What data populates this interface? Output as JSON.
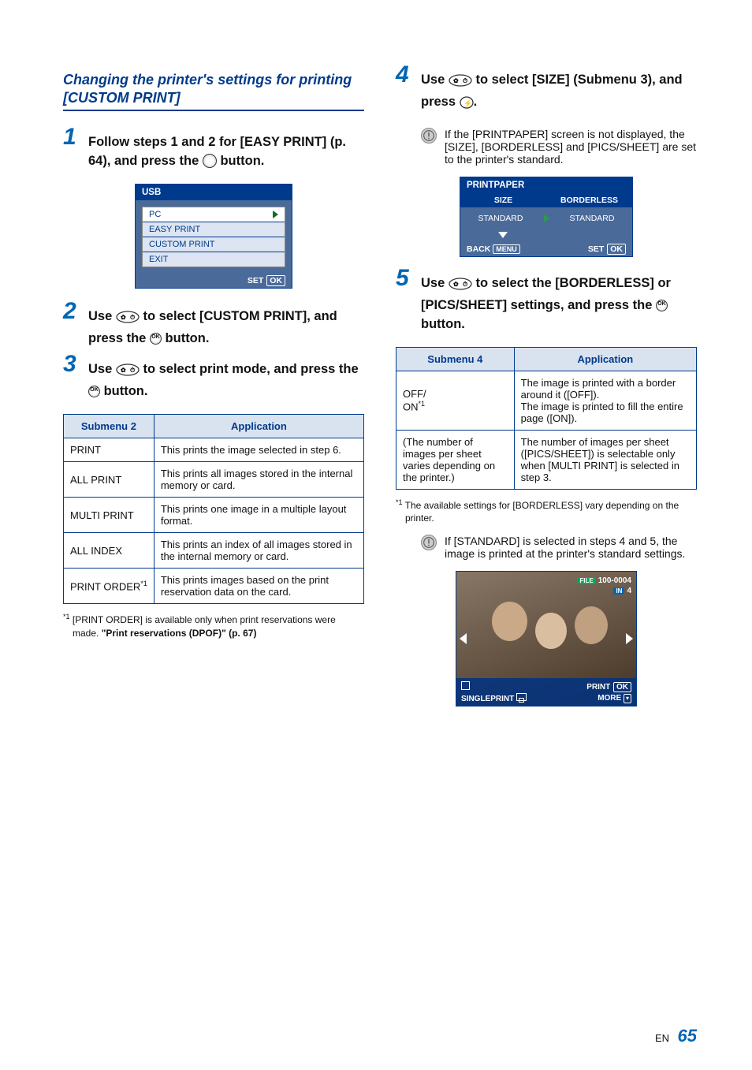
{
  "left": {
    "title": "Changing the printer's settings for printing [CUSTOM PRINT]",
    "step1": {
      "num": "1",
      "label_parts": [
        "Follow steps 1 and 2 for [EASY PRINT] (p. 64), and press the ",
        " button."
      ]
    },
    "usb": {
      "header": "USB",
      "items": [
        "PC",
        "EASY PRINT",
        "CUSTOM PRINT",
        "EXIT"
      ],
      "footer_set": "SET",
      "footer_ok": "OK"
    },
    "step2": {
      "num": "2",
      "label_parts": [
        "Use ",
        " to select [CUSTOM PRINT], and press the ",
        " button."
      ]
    },
    "step3": {
      "num": "3",
      "label_parts": [
        "Use ",
        " to select print mode, and press the ",
        " button."
      ]
    },
    "table": {
      "headers": [
        "Submenu 2",
        "Application"
      ],
      "rows": [
        {
          "k": "PRINT",
          "v": "This prints the image selected in step 6."
        },
        {
          "k": "ALL PRINT",
          "v": "This prints all images stored in the internal memory or card."
        },
        {
          "k": "MULTI PRINT",
          "v": "This prints one image in a multiple layout format."
        },
        {
          "k": "ALL INDEX",
          "v": "This prints an index of all images stored in the internal memory or card."
        },
        {
          "k": "PRINT ORDER",
          "sup": "*1",
          "v": "This prints images based on the print reservation data on the card."
        }
      ]
    },
    "footnote": {
      "sup": "*1",
      "text_a": "[PRINT ORDER] is available only when print reservations were made. ",
      "text_b": "\"Print reservations (DPOF)\" (p. 67)"
    }
  },
  "right": {
    "step4": {
      "num": "4",
      "label_parts": [
        "Use ",
        " to select [SIZE] (Submenu 3), and press ",
        "."
      ]
    },
    "note4": "If the [PRINTPAPER] screen is not displayed, the [SIZE], [BORDERLESS] and [PICS/SHEET] are set to the printer's standard.",
    "pp": {
      "title": "PRINTPAPER",
      "col1": "SIZE",
      "col2": "BORDERLESS",
      "val1": "STANDARD",
      "val2": "STANDARD",
      "back": "BACK",
      "menu": "MENU",
      "set": "SET",
      "ok": "OK"
    },
    "step5": {
      "num": "5",
      "label_parts": [
        "Use ",
        " to select the [BORDERLESS] or [PICS/SHEET] settings, and press the ",
        " button."
      ]
    },
    "table": {
      "headers": [
        "Submenu 4",
        "Application"
      ],
      "rows": [
        {
          "k_a": "OFF/",
          "k_b": "ON",
          "k_sup": "*1",
          "v": "The image is printed with a border around it ([OFF]).\nThe image is printed to fill the entire page ([ON])."
        },
        {
          "k": "(The number of images per sheet varies depending on the printer.)",
          "v": "The number of images per sheet ([PICS/SHEET]) is selectable only when [MULTI PRINT] is selected in step 3."
        }
      ]
    },
    "footnote": {
      "sup": "*1",
      "text": "The available settings for [BORDERLESS] vary depending on the printer."
    },
    "note5": "If [STANDARD] is selected in steps 4 and 5, the image is printed at the printer's standard settings.",
    "photo": {
      "file_tag": "FILE",
      "file_no": "100-0004",
      "in_tag": "IN",
      "count": "4",
      "print": "PRINT",
      "ok": "OK",
      "single": "SINGLEPRINT",
      "more": "MORE"
    }
  },
  "page": {
    "en": "EN",
    "num": "65"
  }
}
